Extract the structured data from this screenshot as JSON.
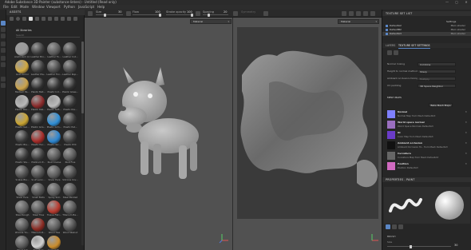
{
  "window": {
    "title": "Adobe Substance 3D Painter (substance-linters) - Untitled (Read only)",
    "controls": [
      "—",
      "▢",
      "✕"
    ]
  },
  "menu": [
    "File",
    "Edit",
    "Mode",
    "Window",
    "Viewport",
    "Python",
    "JavaScript",
    "Help"
  ],
  "toolbar": {
    "size_label": "Size",
    "size_value": "30",
    "flow_label": "Flow",
    "flow_value": "100",
    "stroke_opacity_label": "Stroke opacity",
    "stroke_opacity_value": "100",
    "spacing_label": "Spacing",
    "spacing_value": "20",
    "symmetry_label": "Symmetry"
  },
  "assets": {
    "header": "ASSETS",
    "library": "All libraries",
    "search_placeholder": "Search",
    "materials": [
      {
        "label": "Aluminium Ar...",
        "color": "#9a9a9a"
      },
      {
        "label": "Leather Bro...",
        "color": "#3a3a3a"
      },
      {
        "label": "Leather Fo...",
        "color": "#5a5a5a"
      },
      {
        "label": "Leather Cut...",
        "color": "#444444"
      },
      {
        "label": "Gold Armor",
        "color": "#d1a840"
      },
      {
        "label": "Leather Pla...",
        "color": "#3b3b3b"
      },
      {
        "label": "Leather Fon...",
        "color": "#494949"
      },
      {
        "label": "Leather Rup...",
        "color": "#474747"
      },
      {
        "label": "Medium Pa...",
        "color": "#caa24a"
      },
      {
        "label": "Plastic Mat...",
        "color": "#2e2e2e"
      },
      {
        "label": "Plastic Ind...",
        "color": "#353535"
      },
      {
        "label": "Plastic Glass...",
        "color": "#2f2f2f"
      },
      {
        "label": "Plastic Rou...",
        "color": "#b8b8b8"
      },
      {
        "label": "Plastic Rub...",
        "color": "#8a2a2a"
      },
      {
        "label": "Plastic Soft...",
        "color": "#bbbbbb"
      },
      {
        "label": "Plastic Dia...",
        "color": "#333333"
      },
      {
        "label": "Plastic Gel...",
        "color": "#c9a431"
      },
      {
        "label": "Plastic Gris...",
        "color": "#2d2d2d"
      },
      {
        "label": "Plastic Grm...",
        "color": "#2f8fd6"
      },
      {
        "label": "Plastic Pat...",
        "color": "#383838"
      },
      {
        "label": "Plastic Bla...",
        "color": "#373737"
      },
      {
        "label": "Plastic Hor...",
        "color": "#a52b28"
      },
      {
        "label": "Plastic Glc...",
        "color": "#2c86d1"
      },
      {
        "label": "Plastic PVC",
        "color": "#3f3f3f"
      },
      {
        "label": "Plastic Ste...",
        "color": "#3a3a3a"
      },
      {
        "label": "Platinum P...",
        "color": "#3b3b3b"
      },
      {
        "label": "Rust Coarse",
        "color": "#565656"
      },
      {
        "label": "Rust Fine",
        "color": "#575757"
      },
      {
        "label": "Scales Ble...",
        "color": "#4a4a4a"
      },
      {
        "label": "Scuf Lenin...",
        "color": "#4b4b4b"
      },
      {
        "label": "Silver Pure",
        "color": "#5a5a5a"
      },
      {
        "label": "Silicone Cov...",
        "color": "#494949"
      },
      {
        "label": "Silver Pure",
        "color": "#6d6d6d"
      },
      {
        "label": "Small Bolts",
        "color": "#4d4d4d"
      },
      {
        "label": "Spray Skin",
        "color": "#5c5c5c"
      },
      {
        "label": "Steel Painted",
        "color": "#4f4f4f"
      },
      {
        "label": "Steel Rough",
        "color": "#5f5f5f"
      },
      {
        "label": "Steel Tiles",
        "color": "#555555"
      },
      {
        "label": "Tissue Fibri...",
        "color": "#b83a2e"
      },
      {
        "label": "Titanium Ba...",
        "color": "#545454"
      },
      {
        "label": "Wrinkle Tin...",
        "color": "#545454"
      },
      {
        "label": "Titanium R...",
        "color": "#8a2a22"
      },
      {
        "label": "Wood Tree",
        "color": "#5b5b5b"
      },
      {
        "label": "Wood Walnut",
        "color": "#4c4c4c"
      },
      {
        "label": "Wood Ash",
        "color": "#575757"
      },
      {
        "label": "Zinc Pure",
        "color": "#d0d0d0"
      },
      {
        "label": "Cement B...",
        "color": "#c98c2c"
      }
    ]
  },
  "viewport": {
    "left_mode": "Material",
    "right_mode": "Material"
  },
  "texture_set_list": {
    "header": "TEXTURE SET LIST",
    "settings_label": "Settings",
    "sets": [
      {
        "name": "DefaultA2",
        "shader": "Main shader",
        "selected": false
      },
      {
        "name": "DefaultB2",
        "shader": "Main shader",
        "selected": false
      },
      {
        "name": "DefaultA3",
        "shader": "Main shader",
        "selected": true
      }
    ]
  },
  "tabs": {
    "layers": "LAYERS",
    "texture_set_settings": "TEXTURE SET SETTINGS"
  },
  "texture_settings": {
    "properties": [
      {
        "label": "Normal mixing",
        "value": "Combine",
        "dim": false
      },
      {
        "label": "Height to normal method",
        "value": "Sharp",
        "dim": false
      },
      {
        "label": "Ambient occlusion mixing",
        "value": "Multiply",
        "dim": true
      },
      {
        "label": "UV padding",
        "value": "3D Space Neighbor",
        "dim": false
      }
    ],
    "mesh_maps_header": "MESH MAPS",
    "bake_button": "Bake Mesh Maps",
    "mesh_maps": [
      {
        "title": "Normal",
        "source": "Normal Map from Mesh DefaultA3",
        "color": "#7f80ff"
      },
      {
        "title": "World space normal",
        "source": "World Space Normals DefaultA3",
        "color": "#9a6fc0"
      },
      {
        "title": "ID",
        "source": "Color Map from Mesh DefaultA3",
        "color": "#6a3cc8"
      },
      {
        "title": "Ambient occlusion",
        "source": "Ambient Occlusion M... from Mesh DefaultA3",
        "color": "#111111"
      },
      {
        "title": "Curvature",
        "source": "Curvature Map from Mesh DefaultA3",
        "color": "#666666"
      },
      {
        "title": "Position",
        "source": "Position DefaultA3",
        "color": "#d06ac0"
      }
    ]
  },
  "properties_paint": {
    "header": "PROPERTIES - PAINT",
    "brush_label": "BRUSH",
    "size_label": "Size",
    "size_value": "30"
  }
}
